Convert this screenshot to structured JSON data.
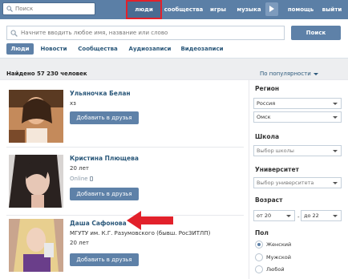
{
  "topbar": {
    "search_placeholder": "Поиск",
    "nav": [
      {
        "label": "люди",
        "active": true
      },
      {
        "label": "сообщества",
        "active": false
      },
      {
        "label": "игры",
        "active": false
      },
      {
        "label": "музыка",
        "active": false
      },
      {
        "label": "помощь",
        "active": false
      },
      {
        "label": "выйти",
        "active": false
      }
    ]
  },
  "search": {
    "placeholder": "Начните вводить любое имя, название или слово",
    "button": "Поиск",
    "tabs": [
      {
        "label": "Люди",
        "active": true
      },
      {
        "label": "Новости",
        "active": false
      },
      {
        "label": "Сообщества",
        "active": false
      },
      {
        "label": "Аудиозаписи",
        "active": false
      },
      {
        "label": "Видеозаписи",
        "active": false
      }
    ]
  },
  "results": {
    "count_text": "Найдено 57 230 человек",
    "sort_label": "По популярности",
    "items": [
      {
        "name": "Ульяночка Белан",
        "line1": "хз",
        "line2": "",
        "add_label": "Добавить в друзья"
      },
      {
        "name": "Кристина Плющева",
        "line1": "20 лет",
        "line2": "Online",
        "add_label": "Добавить в друзья"
      },
      {
        "name": "Даша Сафонова",
        "line1": "МГУТУ им. К.Г. Разумовского (бывш. РосЗИТЛП)",
        "line2": "20 лет",
        "add_label": "Добавить в друзья"
      }
    ]
  },
  "sidebar": {
    "region_label": "Регион",
    "country": "Россия",
    "city": "Омск",
    "school_label": "Школа",
    "school_placeholder": "Выбор школы",
    "university_label": "Университет",
    "university_placeholder": "Выбор университета",
    "age_label": "Возраст",
    "age_from": "от 20",
    "age_sep": "-",
    "age_to": "до 22",
    "gender_label": "Пол",
    "genders": [
      {
        "label": "Женский",
        "checked": true
      },
      {
        "label": "Мужской",
        "checked": false
      },
      {
        "label": "Любой",
        "checked": false
      }
    ]
  },
  "colors": {
    "topbar": "#5b7fa6",
    "accent": "#5e81a8",
    "link": "#2b587a",
    "highlight": "#e2212b"
  }
}
